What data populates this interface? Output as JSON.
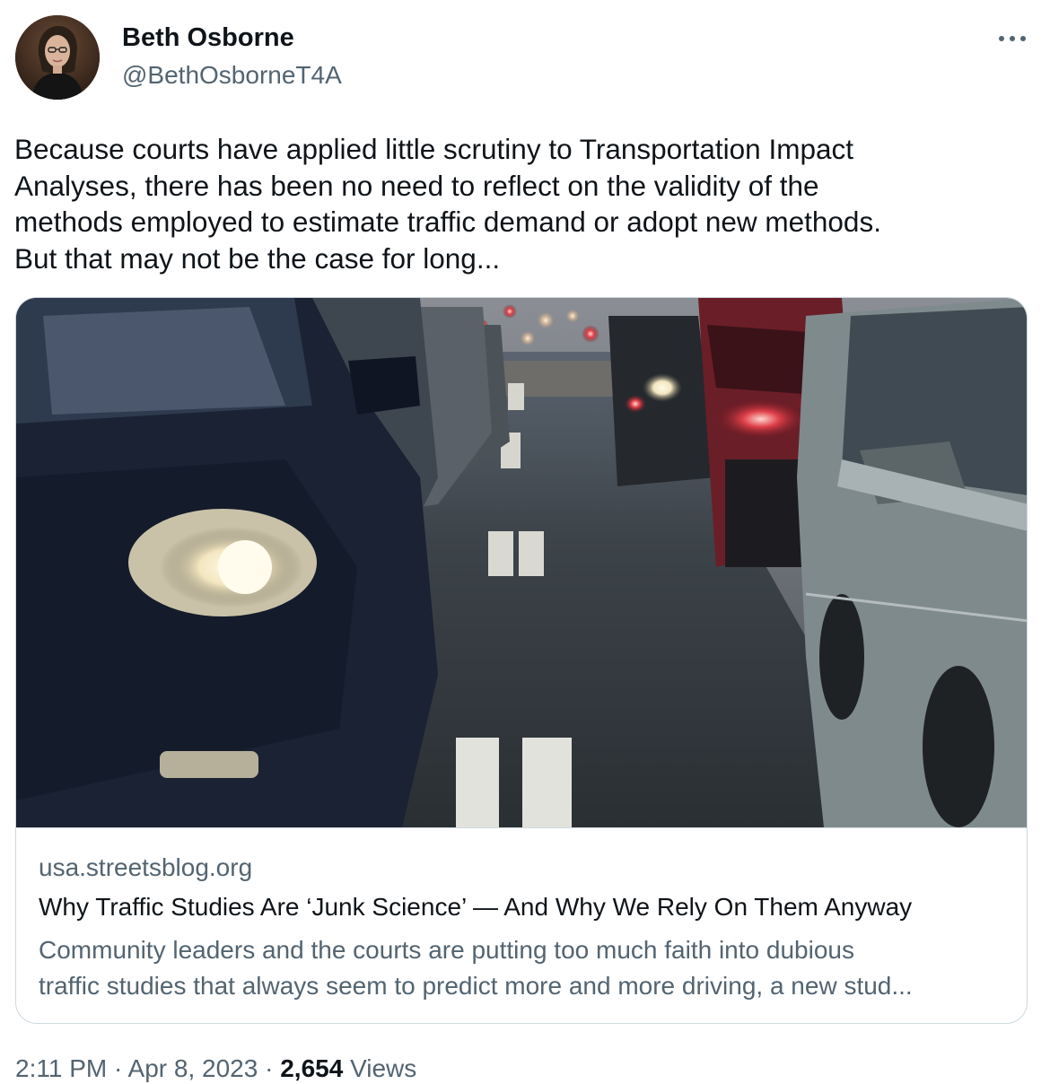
{
  "author": {
    "name": "Beth Osborne",
    "handle": "@BethOsborneT4A",
    "avatar_icon": "profile-photo"
  },
  "more_icon": "more-options-icon",
  "tweet": {
    "text": "Because courts have applied little scrutiny to Transportation Impact\nAnalyses, there has been no need to reflect on the validity of the\nmethods employed to estimate traffic demand or adopt new methods.\nBut that may not be the case for long..."
  },
  "card": {
    "image_icon": "traffic-jam-photo",
    "domain": "usa.streetsblog.org",
    "title": "Why Traffic Studies Are ‘Junk Science’ — And Why We Rely On Them Anyway",
    "description_line1": "Community leaders and the courts are putting too much faith into dubious",
    "description_line2": "traffic studies that always seem to predict more and more driving, a new stud..."
  },
  "meta": {
    "time": "2:11 PM",
    "separator": "·",
    "date": "Apr 8, 2023",
    "views_count": "2,654",
    "views_label": "Views"
  },
  "colors": {
    "text_primary": "#0f1419",
    "text_secondary": "#536471",
    "border": "#cfd9de"
  }
}
